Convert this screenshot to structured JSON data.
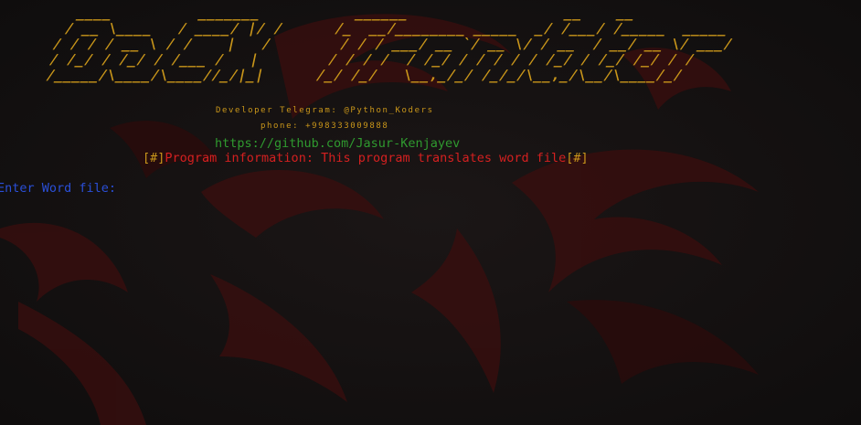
{
  "banner": {
    "ascii_art": "  ____          _______           ______                  __    __\n / __ \\____   / ____/ |/ /      /_  __/________ _____  _/ /___/ /_____  _____\n/ / / / __ \\ / /    |   /        / / / ___/ __ `/ __ \\/ / __  / __/ __ \\/ ___/\n/ /_/ / /_/ / /___ /   |        / / / /  / /_/ / / / / / /_/ / /_/ /_/ / /\n/_____/\\____/\\____//_/|_|      /_/ /_/   \\__,_/_/ /_/_/\\__,_/\\__/\\____/_/",
    "color": "#c9961a"
  },
  "developer_line": "Developer Telegram: @Python_Koders",
  "phone_line": "phone: +998333009888",
  "github_line": "https://github.com/Jasur-Kenjayev",
  "info": {
    "open_bracket": "[#]",
    "text": "Program information: This program translates word file",
    "close_bracket": "[#]"
  },
  "prompt": {
    "label": "Enter Word file: ",
    "value": ""
  },
  "colors": {
    "background": "#161313",
    "accent": "#c9961a",
    "link": "#2f9a2f",
    "info": "#d42020",
    "prompt": "#2a4fd8",
    "wallpaper_red": "#4a1010"
  }
}
